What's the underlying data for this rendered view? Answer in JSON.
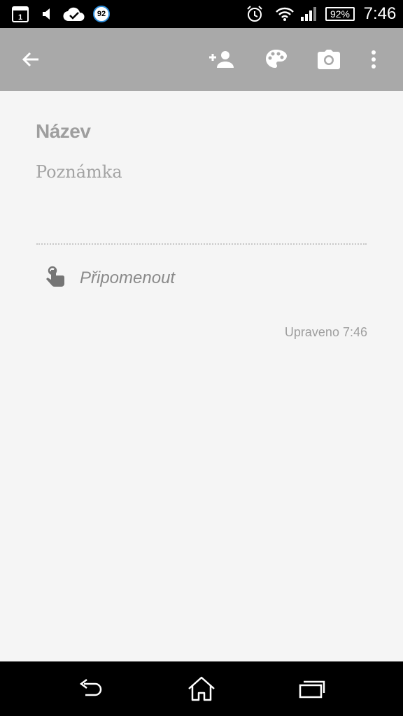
{
  "status_bar": {
    "calendar_day": "1",
    "badge_value": "92",
    "battery_level": "92%",
    "time": "7:46",
    "icons": [
      "calendar-icon",
      "volume-icon",
      "cloud-check-icon",
      "badge-icon",
      "alarm-icon",
      "wifi-icon",
      "signal-icon",
      "battery-icon"
    ]
  },
  "toolbar": {
    "icons": [
      "back-arrow-icon",
      "add-person-icon",
      "palette-icon",
      "camera-icon",
      "more-vertical-icon"
    ]
  },
  "note": {
    "title_placeholder": "Název",
    "body_placeholder": "Poznámka",
    "reminder_label": "Připomenout",
    "edited_label": "Upraveno 7:46"
  },
  "nav_bar": {
    "icons": [
      "nav-back-icon",
      "home-icon",
      "recent-apps-icon"
    ]
  },
  "colors": {
    "toolbar": "#a9a9a9",
    "background": "#f5f5f5",
    "status_bar": "#000000",
    "text_muted": "#9e9e9e"
  }
}
